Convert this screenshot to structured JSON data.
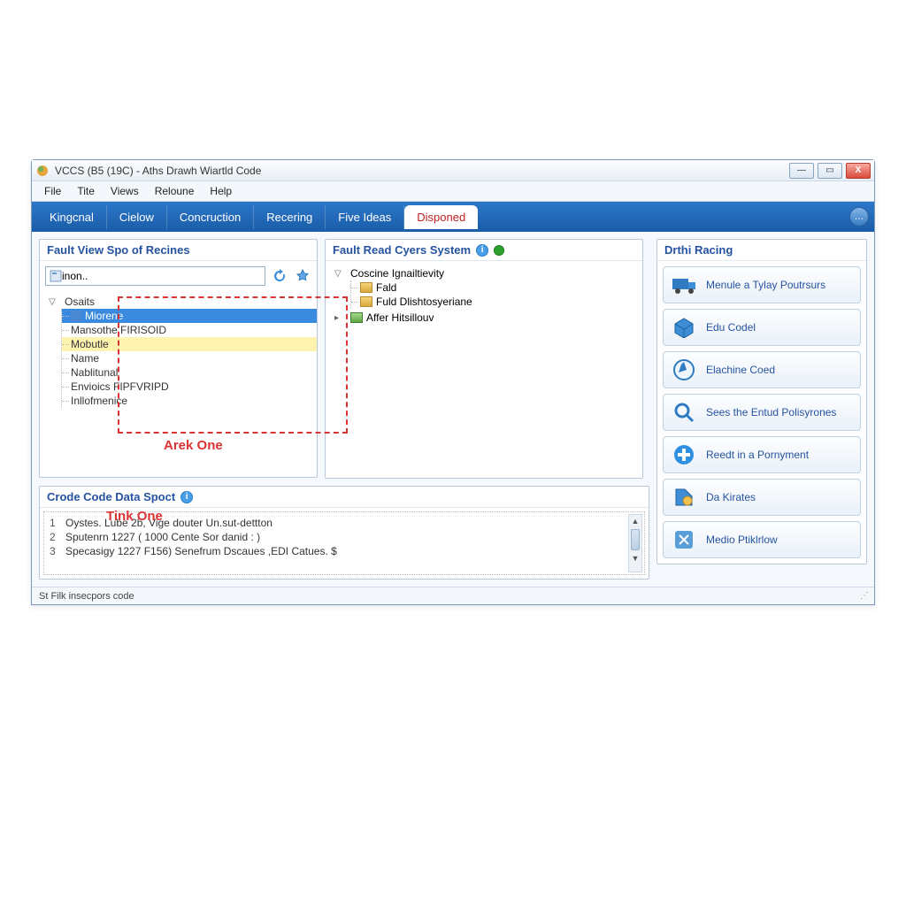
{
  "window": {
    "title": "VCCS (B5 (19C) - Aths Drawh Wiartld Code"
  },
  "menubar": [
    "File",
    "Tite",
    "Views",
    "Reloune",
    "Help"
  ],
  "tabs": {
    "items": [
      "Kingcnal",
      "Cielow",
      "Concruction",
      "Recering",
      "Five Ideas",
      "Disponed"
    ],
    "active_index": 5
  },
  "left_panel": {
    "title": "Fault View Spo of Recines",
    "search_value": "inon..",
    "root": "Osaits",
    "children": [
      "Miorene",
      "Mansothe FIRISOID",
      "Mobutle",
      "Name",
      "Nablitunal",
      "Envioics FIPFVRIPD",
      "Inllofmenice"
    ],
    "selected_index": 0,
    "highlight_index": 2,
    "annotation": "Arek One"
  },
  "mid_panel": {
    "title": "Fault Read Cyers System",
    "root": "Coscine Ignailtievity",
    "root_children": [
      "Fald",
      "Fuld Dlishtosyeriane"
    ],
    "sibling": "Affer Hitsillouv"
  },
  "log_panel": {
    "title": "Crode Code Data Spoct",
    "annotation": "Tink One",
    "rows": [
      {
        "n": "1",
        "text": "Oystes.  Lube   2b, Vige douter Un.sut-dettton"
      },
      {
        "n": "2",
        "text": "Sputenrn  1227 ( 1000 Cente Sor danid : )"
      },
      {
        "n": "3",
        "text": "Specasigy  1227 F156) Senefrum Dscaues ,EDI Catues. $"
      }
    ]
  },
  "right_panel": {
    "title": "Drthi Racing",
    "buttons": [
      "Menule a Tylay Poutrsurs",
      "Edu Codel",
      "Elachine Coed",
      "Sees the Entud Polisyrones",
      "Reedt in a Pornyment",
      "Da Kirates",
      "Medio Ptiklrlow"
    ]
  },
  "status": {
    "text": "St Filk insecpors code"
  }
}
